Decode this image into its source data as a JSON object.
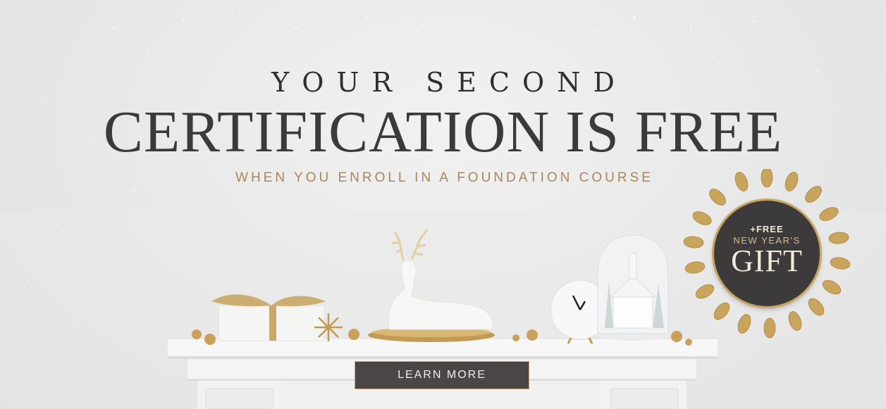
{
  "banner": {
    "eyebrow": "YOUR SECOND",
    "headline": "CERTIFICATION IS FREE",
    "subline": "WHEN YOU ENROLL IN A FOUNDATION COURSE",
    "cta_label": "LEARN MORE"
  },
  "badge": {
    "line1": "+FREE",
    "line2": "NEW YEAR'S",
    "line3": "GIFT"
  },
  "colors": {
    "background": "#ececec",
    "headline": "#3a3a3a",
    "accent_gold": "#c6a560",
    "subline": "#a8865a",
    "cta_background": "#4a4646"
  },
  "decor_icons": [
    "gift-box-icon",
    "reindeer-figurine-icon",
    "clock-icon",
    "snow-globe-house-icon",
    "gold-star-ornament-icon",
    "laurel-wreath-icon"
  ]
}
